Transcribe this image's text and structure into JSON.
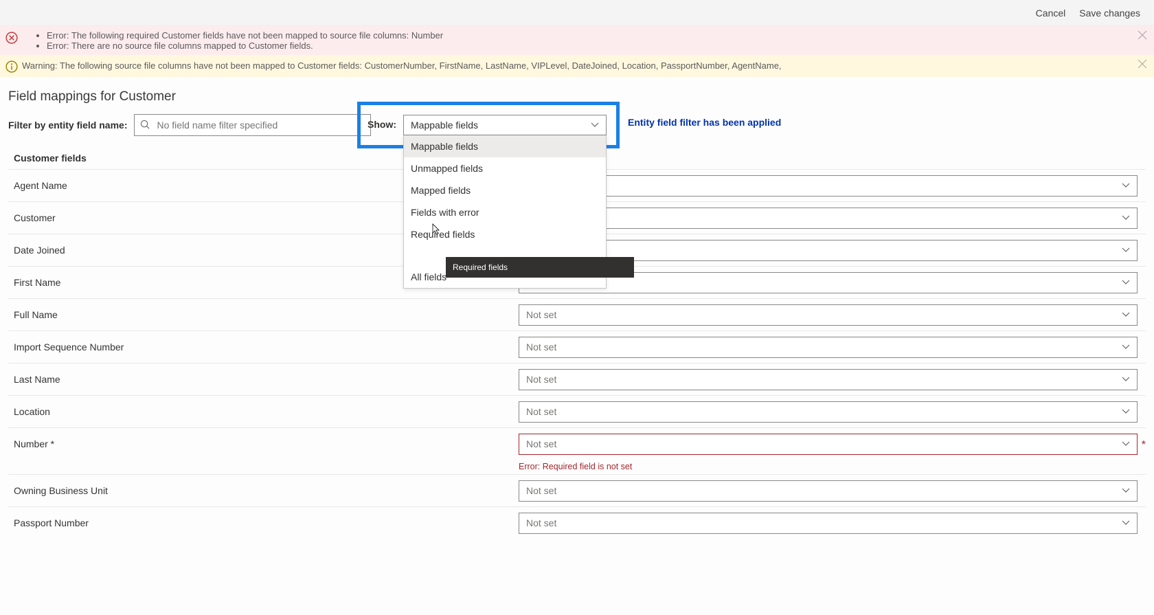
{
  "topbar": {
    "cancel": "Cancel",
    "save": "Save changes"
  },
  "errors": [
    "Error: The following required Customer fields have not been mapped to source file columns: Number",
    "Error: There are no source file columns mapped to Customer fields."
  ],
  "warning": "Warning: The following source file columns have not been mapped to Customer fields: CustomerNumber, FirstName, LastName, VIPLevel, DateJoined, Location, PassportNumber, AgentName,",
  "page_title": "Field mappings for Customer",
  "filter": {
    "label": "Filter by entity field name:",
    "placeholder": "No field name filter specified"
  },
  "show": {
    "label": "Show:",
    "selected": "Mappable fields",
    "options": [
      "Mappable fields",
      "Unmapped fields",
      "Mapped fields",
      "Fields with error",
      "Required fields",
      "All fields"
    ],
    "tooltip": "Required fields"
  },
  "applied_msg": "Entity field filter has been applied",
  "headers": {
    "col1": "Customer fields"
  },
  "not_set": "Not set",
  "fields": [
    {
      "label": "Agent Name"
    },
    {
      "label": "Customer"
    },
    {
      "label": "Date Joined"
    },
    {
      "label": "First Name"
    },
    {
      "label": "Full Name"
    },
    {
      "label": "Import Sequence Number"
    },
    {
      "label": "Last Name"
    },
    {
      "label": "Location"
    },
    {
      "label": "Number *",
      "error": "Error: Required field is not set",
      "required": true
    },
    {
      "label": "Owning Business Unit"
    },
    {
      "label": "Passport Number"
    }
  ]
}
